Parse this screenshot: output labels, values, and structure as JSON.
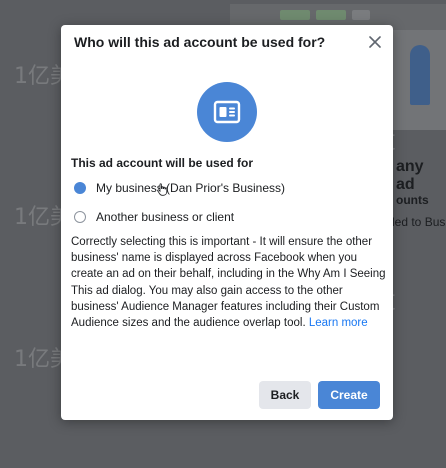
{
  "background": {
    "heading": "any ad",
    "sub1": "ounts",
    "sub2": "led to Bus"
  },
  "watermark": "1亿美金站长阿发",
  "dialog": {
    "title": "Who will this ad account be used for?",
    "close_icon": "close-icon",
    "hero_icon": "ad-account-icon",
    "section_label": "This ad account will be used for",
    "options": [
      {
        "label": "My business (Dan Prior's Business)",
        "checked": true
      },
      {
        "label": "Another business or client",
        "checked": false
      }
    ],
    "description": "Correctly selecting this is important - It will ensure the other business' name is displayed across Facebook when you create an ad on their behalf, including in the Why Am I Seeing This ad dialog. You may also gain access to the other business' Audience Manager features including their Custom Audience sizes and the audience overlap tool.",
    "learn_more": "Learn more",
    "back_label": "Back",
    "create_label": "Create"
  },
  "colors": {
    "accent": "#4a86d6",
    "link": "#1877f2",
    "secondary_button": "#e4e6eb"
  }
}
